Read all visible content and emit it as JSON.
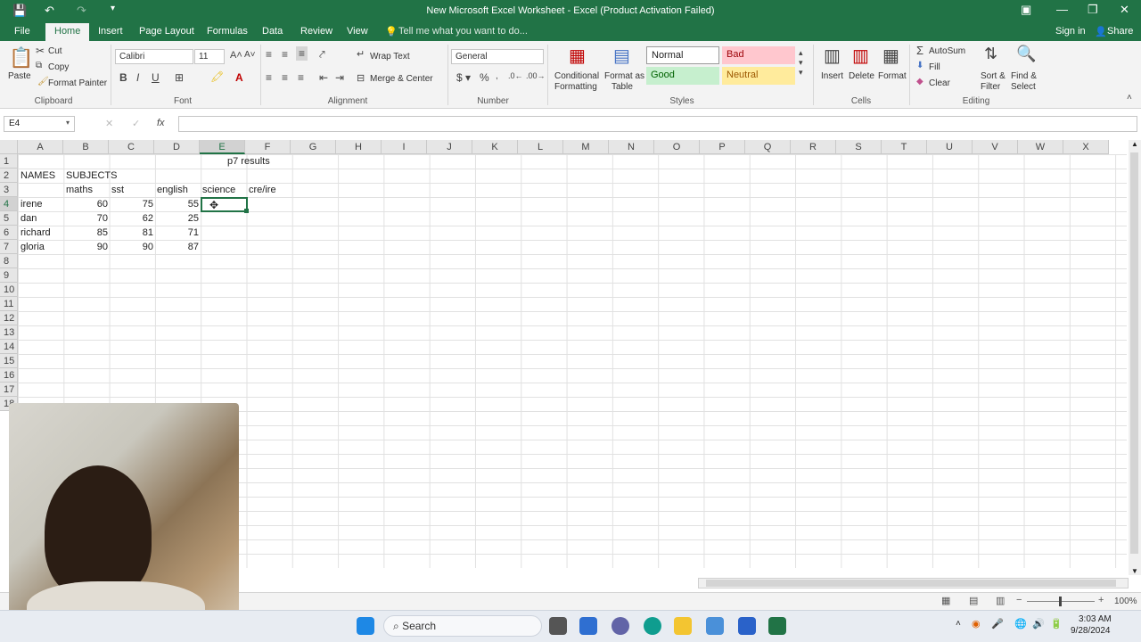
{
  "window": {
    "title": "New Microsoft Excel Worksheet - Excel (Product Activation Failed)"
  },
  "ribbon_tabs": [
    "File",
    "Home",
    "Insert",
    "Page Layout",
    "Formulas",
    "Data",
    "Review",
    "View"
  ],
  "tell_me": "Tell me what you want to do...",
  "account": {
    "sign_in": "Sign in",
    "share": "Share"
  },
  "clipboard": {
    "paste": "Paste",
    "cut": "Cut",
    "copy": "Copy",
    "format_painter": "Format Painter",
    "label": "Clipboard"
  },
  "font": {
    "name": "Calibri",
    "size": "11",
    "label": "Font"
  },
  "alignment": {
    "wrap_text": "Wrap Text",
    "merge_center": "Merge & Center",
    "label": "Alignment"
  },
  "number": {
    "format": "General",
    "label": "Number"
  },
  "styles": {
    "conditional": "Conditional",
    "formatting": "Formatting",
    "format_as": "Format as",
    "table": "Table",
    "normal": "Normal",
    "bad": "Bad",
    "good": "Good",
    "neutral": "Neutral",
    "label": "Styles",
    "colors": {
      "bad_bg": "#ffc7ce",
      "bad_fg": "#9c0006",
      "good_bg": "#c6efce",
      "good_fg": "#006100",
      "neutral_bg": "#ffeb9c",
      "neutral_fg": "#9c5700"
    }
  },
  "cells_group": {
    "insert": "Insert",
    "delete": "Delete",
    "format": "Format",
    "label": "Cells"
  },
  "editing": {
    "autosum": "AutoSum",
    "fill": "Fill",
    "clear": "Clear",
    "sort": "Sort &",
    "filter": "Filter",
    "find": "Find &",
    "select": "Select",
    "label": "Editing"
  },
  "formula_bar": {
    "name_box": "E4",
    "fx": "fx",
    "value": ""
  },
  "columns": [
    "A",
    "B",
    "C",
    "D",
    "E",
    "F",
    "G",
    "H",
    "I",
    "J",
    "K",
    "L",
    "M",
    "N",
    "O",
    "P",
    "Q",
    "R",
    "S",
    "T",
    "U",
    "V",
    "W",
    "X"
  ],
  "rows": [
    "1",
    "2",
    "3",
    "4",
    "5",
    "6",
    "7",
    "8",
    "9",
    "10",
    "11",
    "12",
    "13",
    "14",
    "15",
    "16",
    "17",
    "18"
  ],
  "sheet": {
    "title": "p7 results",
    "names_header": "NAMES",
    "subjects_header": "SUBJECTS",
    "subjects": [
      "maths",
      "sst",
      "english",
      "science",
      "cre/ire"
    ],
    "students": [
      {
        "name": "irene",
        "maths": "60",
        "sst": "75",
        "english": "55"
      },
      {
        "name": "dan",
        "maths": "70",
        "sst": "62",
        "english": "25"
      },
      {
        "name": "richard",
        "maths": "85",
        "sst": "81",
        "english": "71"
      },
      {
        "name": "gloria",
        "maths": "90",
        "sst": "90",
        "english": "87"
      }
    ]
  },
  "status": {
    "zoom": "100%"
  },
  "taskbar": {
    "search": "Search",
    "time": "3:03 AM",
    "date": "9/28/2024"
  }
}
